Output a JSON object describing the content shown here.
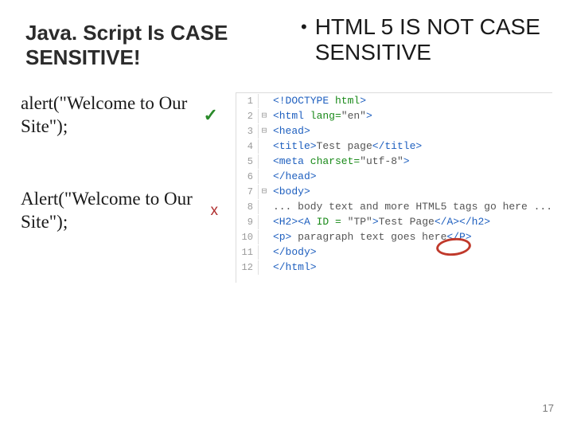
{
  "left_title": "Java. Script Is CASE SENSITIVE!",
  "right_bullet": "HTML 5 IS NOT CASE SENSITIVE",
  "example_ok": "alert(\"Welcome to Our Site\");",
  "example_bad": "Alert(\"Welcome to Our Site\");",
  "tick": "✓",
  "cross": "x",
  "page_number": "17",
  "code": {
    "lines": [
      {
        "n": "1",
        "fold": "",
        "html": "<span class='blue'>&lt;!DOCTYPE</span> <span class='green'>html</span><span class='blue'>&gt;</span>"
      },
      {
        "n": "2",
        "fold": "⊟",
        "html": "<span class='blue'>&lt;html</span> <span class='green'>lang=</span><span class='txt'>\"en\"</span><span class='blue'>&gt;</span>"
      },
      {
        "n": "3",
        "fold": "⊟",
        "html": "<span class='blue'>&lt;head&gt;</span>"
      },
      {
        "n": "4",
        "fold": "",
        "html": "<span class='blue'>&lt;title&gt;</span>Test page<span class='blue'>&lt;/title&gt;</span>"
      },
      {
        "n": "5",
        "fold": "",
        "html": "<span class='blue'>&lt;meta</span> <span class='green'>charset=</span><span class='txt'>\"utf-8\"</span><span class='blue'>&gt;</span>"
      },
      {
        "n": "6",
        "fold": "",
        "html": "<span class='blue'>&lt;/head&gt;</span>"
      },
      {
        "n": "7",
        "fold": "⊟",
        "html": "<span class='blue'>&lt;body&gt;</span>"
      },
      {
        "n": "8",
        "fold": "",
        "html": "... body text and more HTML5 tags go here ..."
      },
      {
        "n": "9",
        "fold": "",
        "html": "<span class='blue'>&lt;H2&gt;&lt;A</span> <span class='green'>ID =</span> <span class='txt'>\"TP\"</span><span class='blue'>&gt;</span>Test Page<span class='blue'>&lt;/A&gt;&lt;/h2&gt;</span>"
      },
      {
        "n": "10",
        "fold": "",
        "html": "<span class='blue'>&lt;p&gt;</span> paragraph text goes here<span class='blue'>&lt;/P&gt;</span>"
      },
      {
        "n": "11",
        "fold": "",
        "html": "<span class='blue'>&lt;/body&gt;</span>"
      },
      {
        "n": "12",
        "fold": "",
        "html": "<span class='blue'>&lt;/html&gt;</span>"
      }
    ]
  }
}
